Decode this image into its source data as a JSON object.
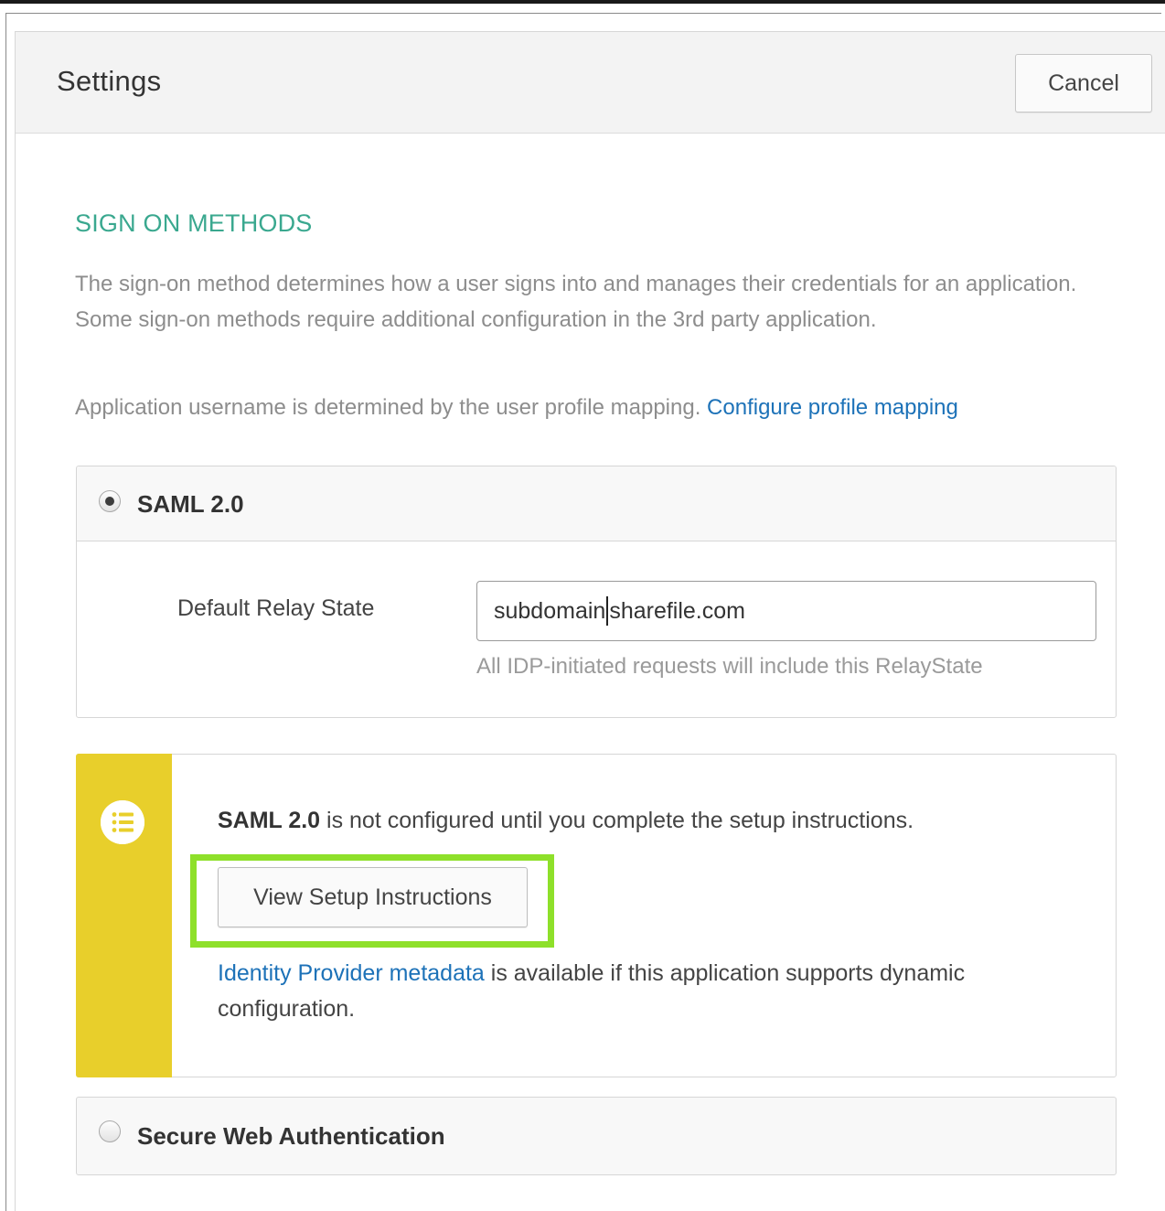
{
  "header": {
    "title": "Settings",
    "cancel_label": "Cancel"
  },
  "sign_on": {
    "heading": "SIGN ON METHODS",
    "description": "The sign-on method determines how a user signs into and manages their credentials for an application. Some sign-on methods require additional configuration in the 3rd party application.",
    "username_note": "Application username is determined by the user profile mapping.",
    "profile_link": "Configure profile mapping"
  },
  "methods": {
    "saml": {
      "label": "SAML 2.0",
      "selected": true,
      "relay_state_label": "Default Relay State",
      "relay_state_value_before_caret": "subdomain",
      "relay_state_value_after_caret": "sharefile.com",
      "relay_state_help": "All IDP-initiated requests will include this RelayState"
    },
    "swa": {
      "label": "Secure Web Authentication",
      "selected": false
    }
  },
  "notice": {
    "icon": "list-icon",
    "stripe_color": "#e8cf2b",
    "bold_part": "SAML 2.0",
    "message_rest": " is not configured until you complete the setup instructions.",
    "button_label": "View Setup Instructions",
    "highlight_color": "#8ee02a",
    "metadata_link": "Identity Provider metadata",
    "metadata_rest": " is available if this application supports dynamic configuration."
  }
}
